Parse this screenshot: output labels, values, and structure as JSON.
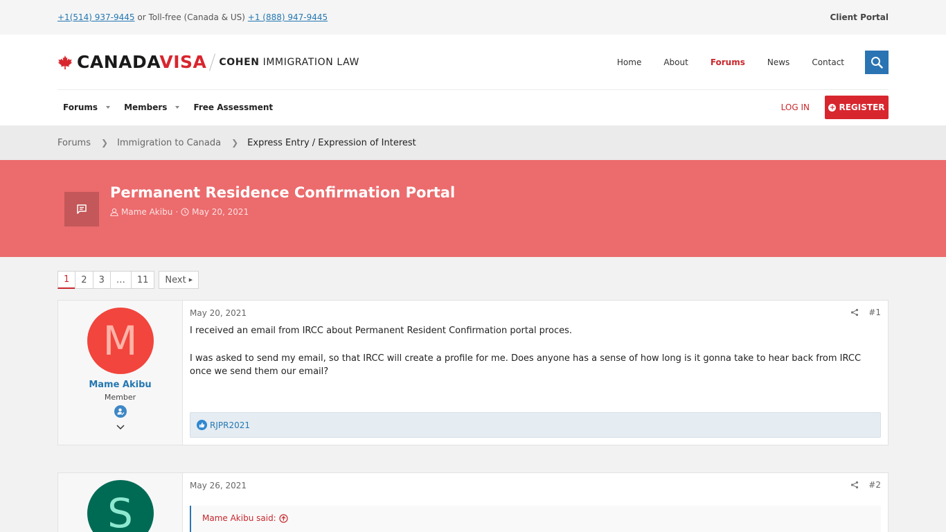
{
  "topbar": {
    "phone_main": "+1(514) 937-9445",
    "phone_sep": " or Toll-free (Canada & US) ",
    "phone_tollfree": "+1 (888) 947-9445",
    "client_portal": "Client Portal"
  },
  "logo": {
    "canada": "CANADA",
    "visa": "VISA",
    "cohen_bold": "COHEN",
    "cohen_rest": " IMMIGRATION LAW"
  },
  "main_nav": [
    {
      "label": "Home",
      "active": false
    },
    {
      "label": "About",
      "active": false
    },
    {
      "label": "Forums",
      "active": true
    },
    {
      "label": "News",
      "active": false
    },
    {
      "label": "Contact",
      "active": false
    }
  ],
  "sub_nav": {
    "forums": "Forums",
    "members": "Members",
    "free_assessment": "Free Assessment",
    "login": "LOG IN",
    "register": "REGISTER"
  },
  "breadcrumb": {
    "items": [
      "Forums",
      "Immigration to Canada"
    ],
    "current": "Express Entry / Expression of Interest"
  },
  "thread": {
    "title": "Permanent Residence Confirmation Portal",
    "author": "Mame Akibu",
    "date": "May 20, 2021"
  },
  "pagination": {
    "pages": [
      "1",
      "2",
      "3",
      "…",
      "11"
    ],
    "current": "1",
    "next": "Next"
  },
  "posts": [
    {
      "avatar_letter": "M",
      "avatar_bg": "#f1453d",
      "avatar_fg": "#ffb3a8",
      "username": "Mame Akibu",
      "role": "Member",
      "date": "May 20, 2021",
      "number": "#1",
      "paragraphs": [
        "I received an email from IRCC about Permanent Resident Confirmation portal proces.",
        "I was asked to send my email, so that IRCC will create a profile for me. Does anyone has a sense of how long is it gonna take to hear back from IRCC once we send them our email?"
      ],
      "reaction_user": "RJPR2021"
    },
    {
      "avatar_letter": "S",
      "avatar_bg": "#006b55",
      "avatar_fg": "#8ee8cf",
      "date": "May 26, 2021",
      "number": "#2",
      "quote_attribution": "Mame Akibu said:"
    }
  ],
  "colors": {
    "brand_red": "#d8262e",
    "banner": "#ec6b6d",
    "link_blue": "#2577b1"
  }
}
